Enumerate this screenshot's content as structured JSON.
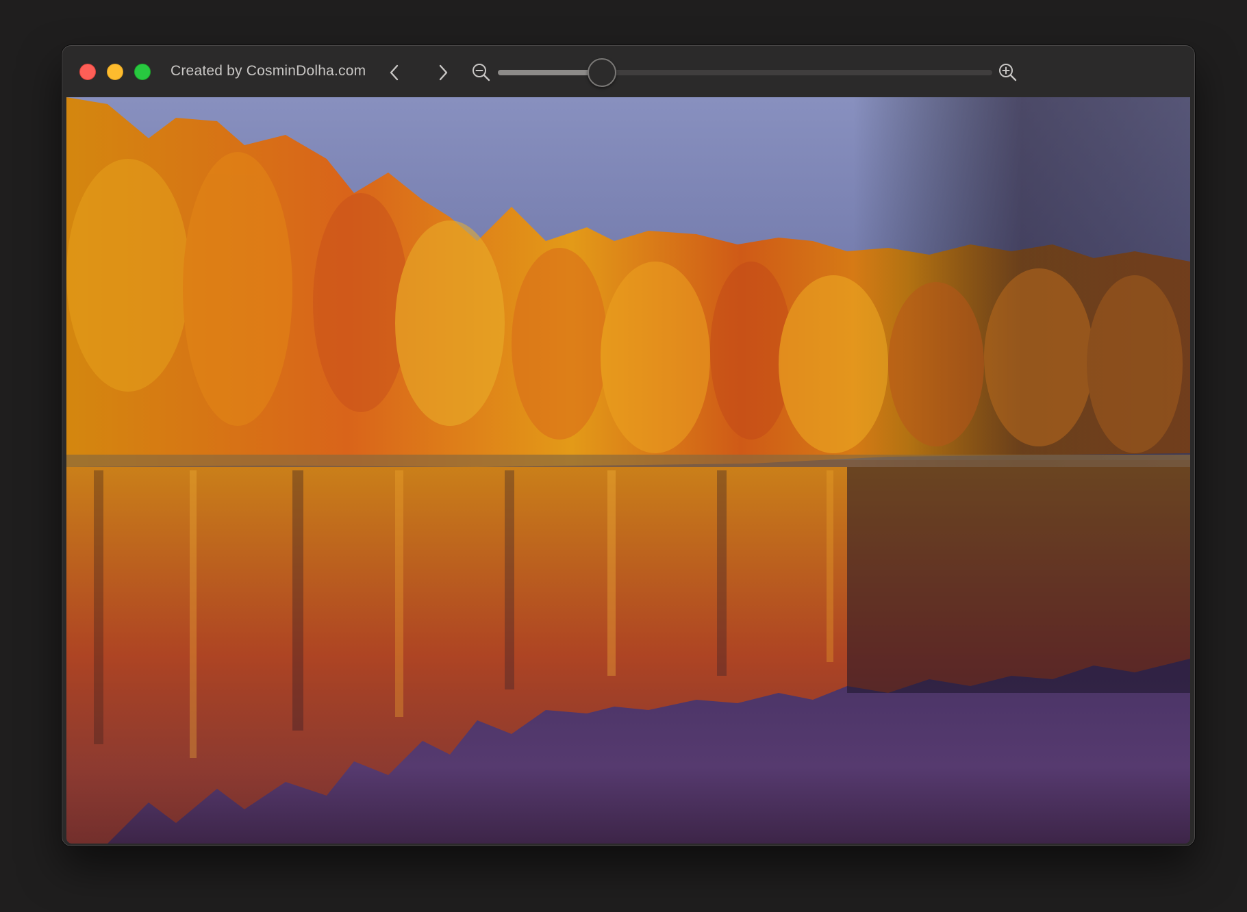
{
  "window": {
    "title": "Created by CosminDolha.com",
    "buttons": {
      "close_color": "#fe5f57",
      "minimize_color": "#febc2e",
      "maximize_color": "#28c840"
    }
  },
  "toolbar": {
    "prev_icon": "chevron-left-icon",
    "next_icon": "chevron-right-icon",
    "zoom_out_icon": "zoom-out-icon",
    "zoom_in_icon": "zoom-in-icon",
    "zoom_level_fraction": 0.21
  },
  "image": {
    "description_icon": "autumn-lake-photo",
    "colors": {
      "sky": "#7f86b5",
      "foliage": "#e08a14",
      "water": "#3a2850"
    }
  }
}
